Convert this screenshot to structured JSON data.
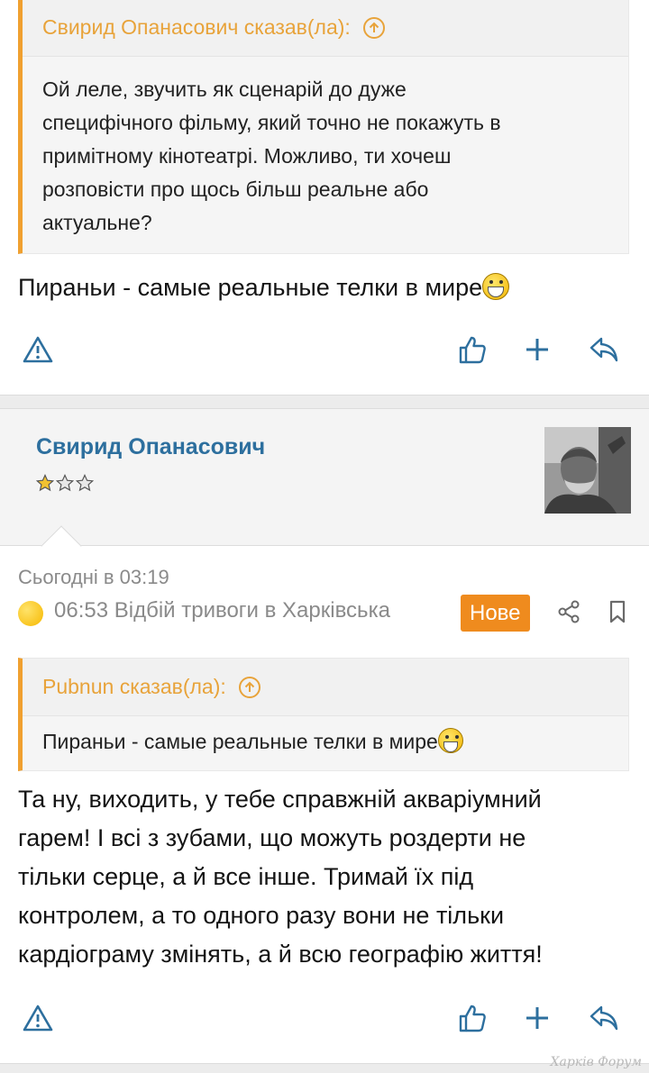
{
  "post1": {
    "quote": {
      "author": "Свирид Опанасович сказав(ла):",
      "lines": [
        "Ой леле, звучить як сценарій до дуже",
        "специфічного фільму, який точно не покажуть в",
        "примітному кінотеатрі. Можливо, ти хочеш",
        "розповісти про щось більш реальне або",
        "актуальне?"
      ]
    },
    "text": "Пираньи - самые реальные телки в мире",
    "text_emoji": "grinning-smiley-icon"
  },
  "post2": {
    "username": "Свирид Опанасович",
    "rank_stars": {
      "filled": 1,
      "total": 3
    },
    "date": "Сьогодні в 03:19",
    "thread_title": "06:53 Відбій тривоги в Харківська",
    "badge": "Нове",
    "quote": {
      "author": "Pubnun сказав(ла):",
      "text": "Пираньи - самые реальные телки в мире"
    },
    "lines": [
      "Та ну, виходить, у тебе справжній акваріумний",
      "гарем! І всі з зубами, що можуть роздерти не",
      "тільки серце, а й все інше. Тримай їх під",
      "контролем, а то одного разу вони не тільки",
      "кардіограму змінять, а й всю географію життя!"
    ]
  },
  "actions": [
    "report-icon",
    "like-icon",
    "plus-icon",
    "reply-icon"
  ],
  "watermark": "Харків Форум",
  "colors": {
    "accent": "#ef8b1e",
    "quote_border": "#f0a030",
    "username": "#2d6f9e",
    "icon": "#2d6f9e"
  }
}
